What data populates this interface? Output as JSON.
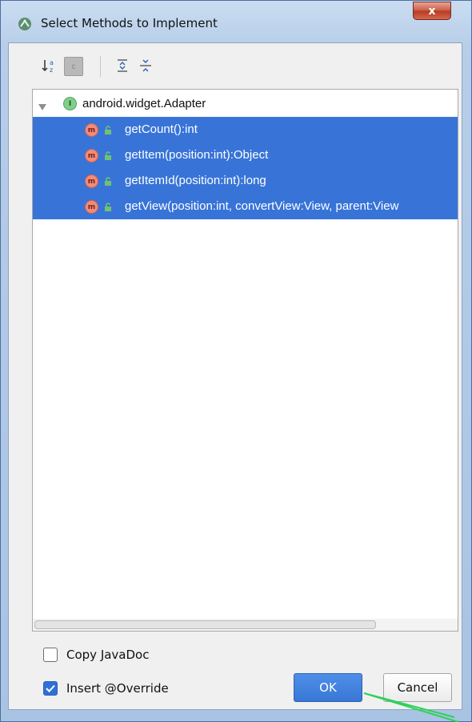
{
  "window": {
    "title": "Select Methods to Implement",
    "close_label": "x"
  },
  "toolbar": {
    "buttons": [
      {
        "icon": "sort-alphabetically-icon"
      },
      {
        "icon": "show-classes-icon",
        "label": "c"
      },
      {
        "icon": "expand-all-icon"
      },
      {
        "icon": "collapse-all-icon"
      }
    ]
  },
  "tree": {
    "root": {
      "icon": "interface-icon",
      "icon_letter": "I",
      "label": "android.widget.Adapter"
    },
    "methods": [
      {
        "icon": "method-icon",
        "icon_letter": "m",
        "label": "getCount():int"
      },
      {
        "icon": "method-icon",
        "icon_letter": "m",
        "label": "getItem(position:int):Object"
      },
      {
        "icon": "method-icon",
        "icon_letter": "m",
        "label": "getItemId(position:int):long"
      },
      {
        "icon": "method-icon",
        "icon_letter": "m",
        "label": "getView(position:int, convertView:View, parent:View"
      }
    ]
  },
  "options": {
    "copy_javadoc": {
      "label": "Copy JavaDoc",
      "checked": false
    },
    "insert_override": {
      "label": "Insert @Override",
      "checked": true
    }
  },
  "buttons": {
    "ok": "OK",
    "cancel": "Cancel"
  },
  "colors": {
    "selection": "#3874d8",
    "ok_button": "#3a77d6",
    "annotation_arrow": "#2fd15a"
  }
}
